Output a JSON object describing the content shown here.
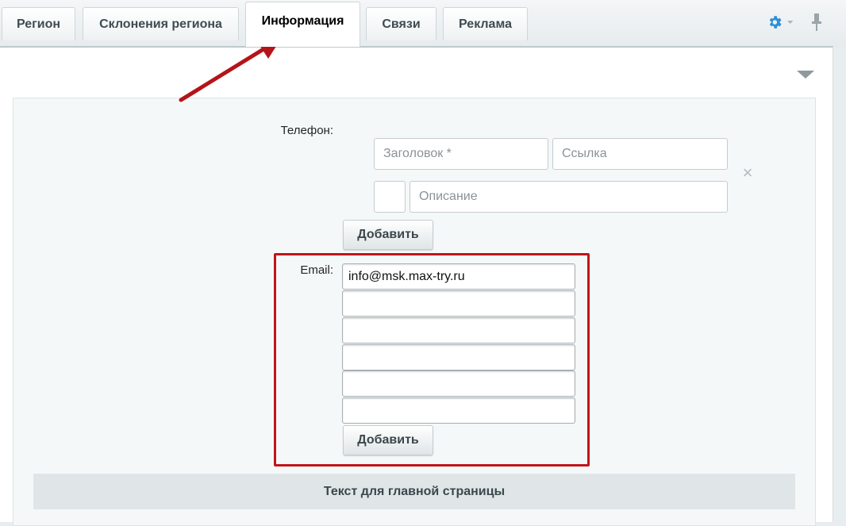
{
  "tabs": [
    {
      "label": "Регион",
      "active": false
    },
    {
      "label": "Склонения региона",
      "active": false
    },
    {
      "label": "Информация",
      "active": true
    },
    {
      "label": "Связи",
      "active": false
    },
    {
      "label": "Реклама",
      "active": false
    }
  ],
  "phone": {
    "label": "Телефон:",
    "title_placeholder": "Заголовок *",
    "link_placeholder": "Ссылка",
    "description_placeholder": "Описание",
    "icon_value": "",
    "add_label": "Добавить"
  },
  "email": {
    "label": "Email:",
    "values": [
      "info@msk.max-try.ru",
      "",
      "",
      "",
      "",
      ""
    ],
    "add_label": "Добавить"
  },
  "section": {
    "main_text_title": "Текст для главной страницы"
  },
  "colors": {
    "accent": "#2d8fd6",
    "highlight": "#c0151a"
  }
}
